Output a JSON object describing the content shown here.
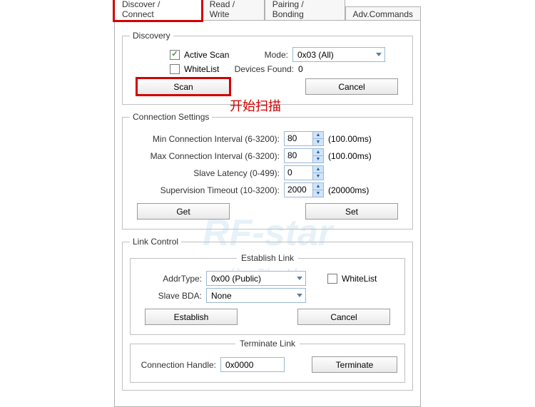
{
  "tabs": {
    "discover": "Discover / Connect",
    "rw": "Read / Write",
    "pair": "Pairing / Bonding",
    "adv": "Adv.Commands"
  },
  "discovery": {
    "legend": "Discovery",
    "active_scan": "Active Scan",
    "whitelist": "WhiteList",
    "mode_label": "Mode:",
    "mode_value": "0x03 (All)",
    "devices_found_label": "Devices Found:",
    "devices_found_value": "0",
    "scan": "Scan",
    "cancel": "Cancel"
  },
  "annot_scan": "开始扫描",
  "conn": {
    "legend": "Connection Settings",
    "min_label": "Min Connection Interval (6-3200):",
    "min_value": "80",
    "min_hint": "(100.00ms)",
    "max_label": "Max Connection Interval (6-3200):",
    "max_value": "80",
    "max_hint": "(100.00ms)",
    "lat_label": "Slave Latency (0-499):",
    "lat_value": "0",
    "sup_label": "Supervision Timeout (10-3200):",
    "sup_value": "2000",
    "sup_hint": "(20000ms)",
    "get": "Get",
    "set": "Set"
  },
  "linkctrl": {
    "legend": "Link Control",
    "establish_legend": "Establish Link",
    "addrtype_label": "AddrType:",
    "addrtype_value": "0x00 (Public)",
    "whitelist": "WhiteList",
    "bda_label": "Slave BDA:",
    "bda_value": "None",
    "establish": "Establish",
    "cancel": "Cancel",
    "terminate_legend": "Terminate Link",
    "handle_label": "Connection Handle:",
    "handle_value": "0x0000",
    "terminate": "Terminate"
  },
  "watermark": "RF-star",
  "watermark2": "信 驰 达"
}
